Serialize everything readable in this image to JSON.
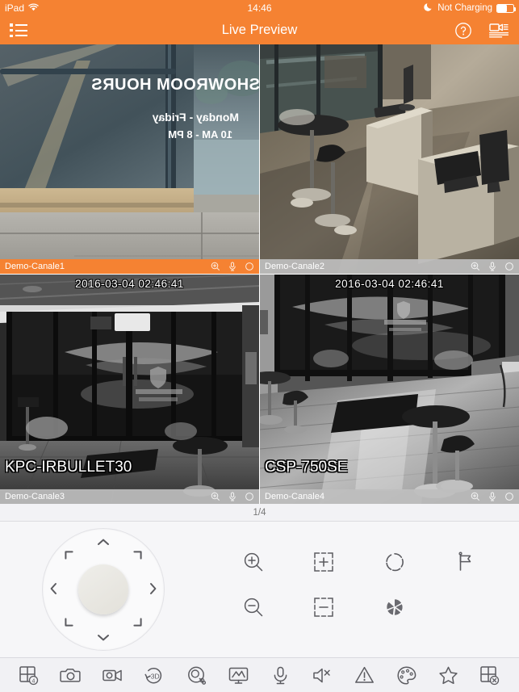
{
  "status_bar": {
    "device": "iPad",
    "wifi_icon": "wifi-icon",
    "time": "14:46",
    "moon_icon": "moon-icon",
    "charge_text": "Not Charging",
    "battery_icon": "battery-icon",
    "battery_level": 62
  },
  "nav_bar": {
    "menu_icon": "list-menu-icon",
    "title": "Live Preview",
    "help_icon": "help-circle-icon",
    "device_list_icon": "camera-device-list-icon"
  },
  "theme": {
    "accent": "#F58232",
    "bar_inactive": "#BEBEBE",
    "panel_bg": "#F6F6F8",
    "toolbar_bg": "#F1F1F4",
    "icon_stroke": "#5B5B60"
  },
  "tiles": [
    {
      "name": "Demo-Canale1",
      "selected": true,
      "osd_time": "",
      "osd_name": "",
      "tools": [
        "digital-zoom-icon",
        "microphone-icon",
        "record-icon"
      ],
      "scene": "storefront-window-daylight"
    },
    {
      "name": "Demo-Canale2",
      "selected": false,
      "osd_time": "",
      "osd_name": "",
      "tools": [
        "digital-zoom-icon",
        "microphone-icon",
        "record-icon"
      ],
      "scene": "showroom-interior-counter"
    },
    {
      "name": "Demo-Canale3",
      "selected": false,
      "osd_time": "2016-03-04 02:46:41",
      "osd_name": "KPC-IRBULLET30",
      "tools": [
        "digital-zoom-icon",
        "microphone-icon",
        "record-icon"
      ],
      "scene": "night-glass-doors-bw"
    },
    {
      "name": "Demo-Canale4",
      "selected": false,
      "osd_time": "2016-03-04 02:46:41",
      "osd_name": "CSP-750SE",
      "tools": [
        "digital-zoom-icon",
        "microphone-icon",
        "record-icon"
      ],
      "scene": "night-lobby-stools-bw"
    }
  ],
  "pager": {
    "label": "1/4"
  },
  "ptz": {
    "joystick_icon": "ptz-joystick",
    "center_icon": "ptz-center-button",
    "directions": [
      "up",
      "up-right",
      "right",
      "down-right",
      "down",
      "down-left",
      "left",
      "up-left"
    ],
    "functions": [
      {
        "name": "zoom-in-icon",
        "row": 1,
        "col": 1
      },
      {
        "name": "focus-near-icon",
        "row": 1,
        "col": 2
      },
      {
        "name": "iris-open-icon",
        "row": 1,
        "col": 3
      },
      {
        "name": "preset-flag-icon",
        "row": 1,
        "col": 4
      },
      {
        "name": "zoom-out-icon",
        "row": 2,
        "col": 1
      },
      {
        "name": "focus-far-icon",
        "row": 2,
        "col": 2
      },
      {
        "name": "iris-close-icon",
        "row": 2,
        "col": 3
      }
    ]
  },
  "toolbar": {
    "items": [
      {
        "name": "layout-split-icon",
        "badge": "4"
      },
      {
        "name": "snapshot-camera-icon",
        "badge": ""
      },
      {
        "name": "record-video-icon",
        "badge": ""
      },
      {
        "name": "three-d-positioning-icon",
        "badge": "3D"
      },
      {
        "name": "ptz-control-icon",
        "badge": ""
      },
      {
        "name": "playback-monitor-icon",
        "badge": ""
      },
      {
        "name": "two-way-audio-icon",
        "badge": ""
      },
      {
        "name": "speaker-mute-icon",
        "badge": ""
      },
      {
        "name": "alarm-warning-icon",
        "badge": ""
      },
      {
        "name": "image-color-palette-icon",
        "badge": ""
      },
      {
        "name": "favorites-star-icon",
        "badge": ""
      },
      {
        "name": "close-all-windows-icon",
        "badge": ""
      }
    ]
  }
}
